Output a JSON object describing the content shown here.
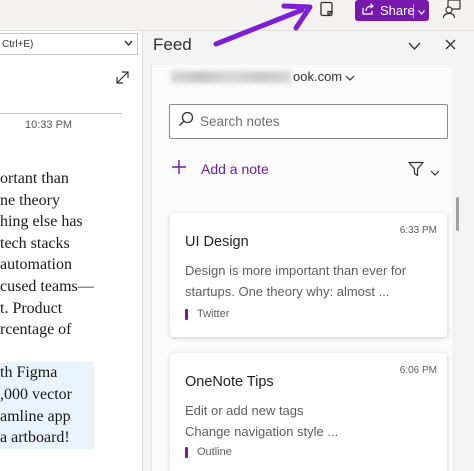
{
  "toolbar": {
    "share_label": "Share",
    "feed_toggle_icon": "notes-feed-icon",
    "profile_icon": "person-feedback-icon",
    "accent": "#7719aa"
  },
  "page": {
    "search_hint": "Ctrl+E)",
    "time": "10:33 PM",
    "lines": [
      "ortant than",
      "ne theory",
      "hing else has",
      " tech stacks",
      "automation",
      "cused teams—",
      "t. Product",
      "rcentage of",
      "",
      "th Figma",
      ",000 vector",
      "amline app",
      "a artboard!"
    ]
  },
  "feed": {
    "title": "Feed",
    "account_suffix": "ook.com",
    "search_placeholder": "Search notes",
    "add_note_label": "Add a note",
    "notes": [
      {
        "title": "UI Design",
        "time": "6:33 PM",
        "body_lines": [
          "Design is more important than ever for",
          "startups. One theory why: almost ..."
        ],
        "source": "Twitter"
      },
      {
        "title": "OneNote Tips",
        "time": "6:06 PM",
        "body_lines": [
          "Edit or add new tags",
          "Change navigation style ..."
        ],
        "source": "Outline"
      }
    ]
  }
}
